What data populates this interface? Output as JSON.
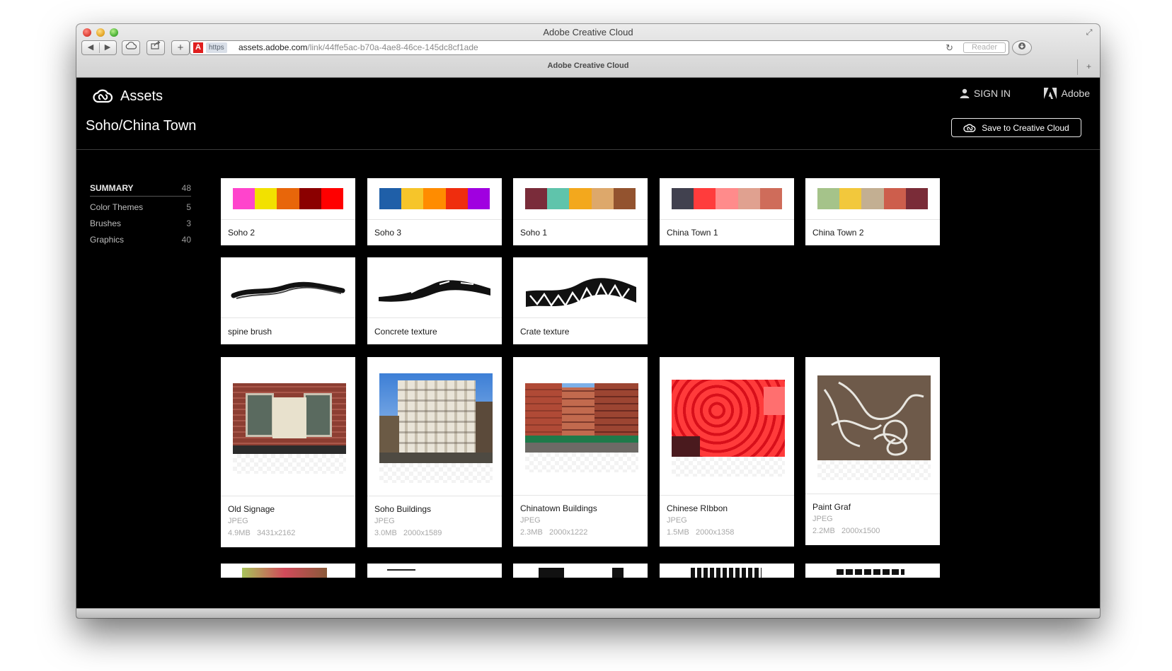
{
  "window": {
    "title": "Adobe Creative Cloud"
  },
  "browser": {
    "url_scheme": "https",
    "url_host": "assets.adobe.com",
    "url_path": "/link/44ffe5ac-b70a-4ae8-46ce-145dc8cf1ade",
    "reader_label": "Reader",
    "tab_title": "Adobe Creative Cloud"
  },
  "header": {
    "app_name": "Assets",
    "signin_label": "SIGN IN",
    "adobe_label": "Adobe",
    "collection_title": "Soho/China Town",
    "save_label": "Save to Creative Cloud"
  },
  "sidebar": {
    "items": [
      {
        "label": "SUMMARY",
        "count": "48"
      },
      {
        "label": "Color Themes",
        "count": "5"
      },
      {
        "label": "Brushes",
        "count": "3"
      },
      {
        "label": "Graphics",
        "count": "40"
      }
    ]
  },
  "color_themes": [
    {
      "name": "Soho 2",
      "colors": [
        "#ff44cc",
        "#f2e100",
        "#e8660a",
        "#8b0000",
        "#ff0000"
      ]
    },
    {
      "name": "Soho 3",
      "colors": [
        "#1f5fa8",
        "#f6c52a",
        "#ff8c00",
        "#ef2d0e",
        "#a000e0"
      ]
    },
    {
      "name": "Soho 1",
      "colors": [
        "#7a2c3a",
        "#5fc4ab",
        "#f3a81d",
        "#dda86b",
        "#93532f"
      ]
    },
    {
      "name": "China Town 1",
      "colors": [
        "#41414f",
        "#ff3c3c",
        "#ff8b8b",
        "#e0a190",
        "#cf6c5a"
      ]
    },
    {
      "name": "China Town 2",
      "colors": [
        "#a5c38a",
        "#f2c83c",
        "#c3af92",
        "#cd5e4c",
        "#7a2c38"
      ]
    }
  ],
  "brushes": [
    {
      "name": "spine brush"
    },
    {
      "name": "Concrete texture"
    },
    {
      "name": "Crate texture"
    }
  ],
  "graphics": [
    {
      "name": "Old Signage",
      "format": "JPEG",
      "size": "4.9MB",
      "dimensions": "3431x2162"
    },
    {
      "name": "Soho Buildings",
      "format": "JPEG",
      "size": "3.0MB",
      "dimensions": "2000x1589"
    },
    {
      "name": "Chinatown Buildings",
      "format": "JPEG",
      "size": "2.3MB",
      "dimensions": "2000x1222"
    },
    {
      "name": "Chinese RIbbon",
      "format": "JPEG",
      "size": "1.5MB",
      "dimensions": "2000x1358"
    },
    {
      "name": "Paint Graf",
      "format": "JPEG",
      "size": "2.2MB",
      "dimensions": "2000x1500"
    }
  ]
}
